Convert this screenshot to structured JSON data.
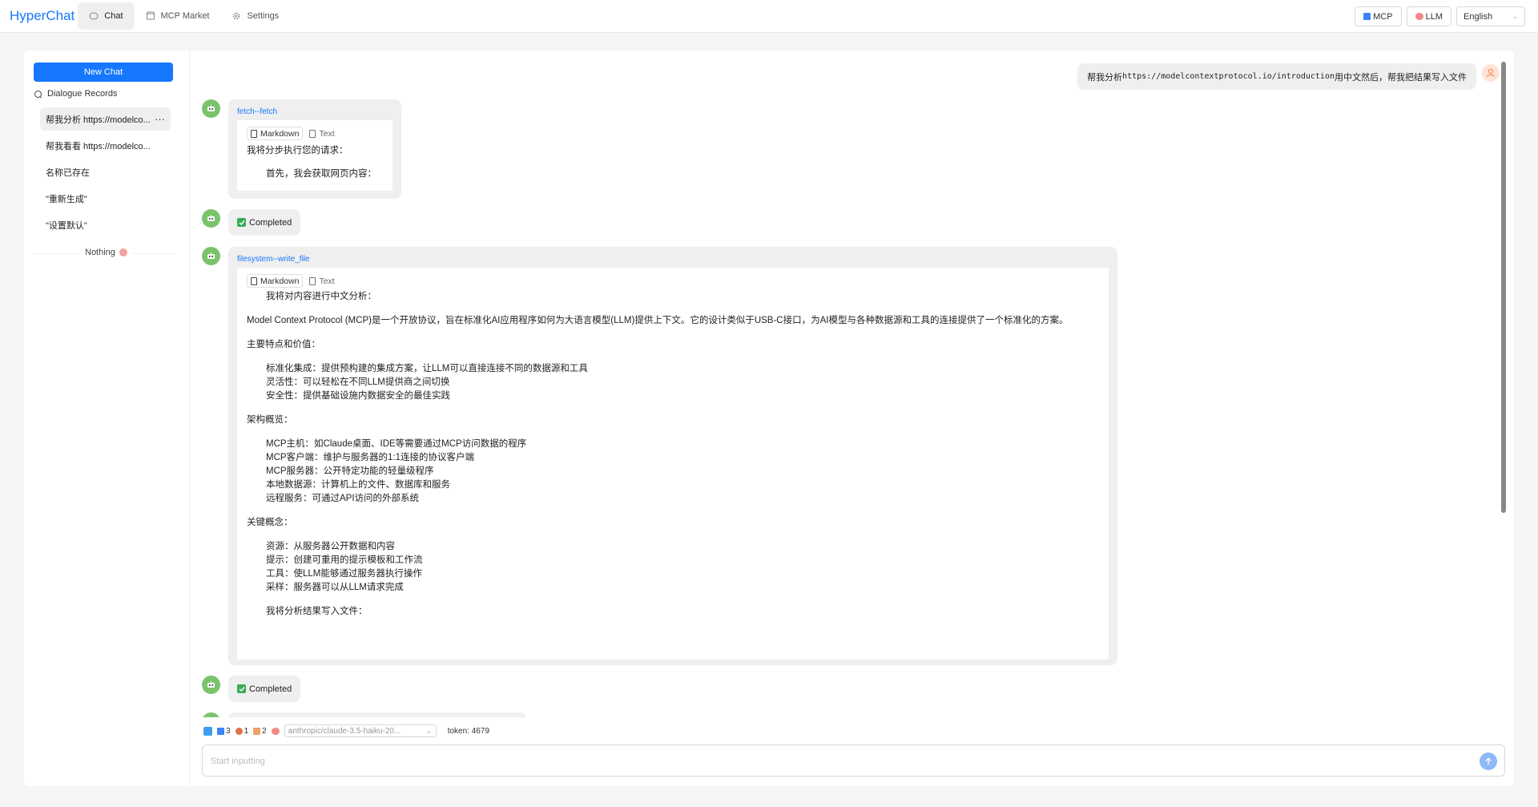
{
  "app": {
    "title": "HyperChat"
  },
  "nav": {
    "tabs": [
      {
        "label": "Chat",
        "icon": "chat-bubble-icon",
        "active": true
      },
      {
        "label": "MCP Market",
        "icon": "shop-icon",
        "active": false
      },
      {
        "label": "Settings",
        "icon": "gear-icon",
        "active": false
      }
    ]
  },
  "header_right": {
    "mcp_label": "MCP",
    "llm_label": "LLM",
    "language": "English"
  },
  "sidebar": {
    "new_chat_label": "New Chat",
    "records_title": "Dialogue Records",
    "records": [
      "帮我分析 https://modelco...",
      "帮我看看 https://modelco...",
      "名称已存在",
      "\"重新生成\"",
      "\"设置默认\""
    ],
    "more_label": "···",
    "empty_label": "Nothing"
  },
  "chat": {
    "user_message": {
      "prefix": "帮我分析 ",
      "url": "https://modelcontextprotocol.io/introduction",
      "suffix": "用中文然后，帮我把结果写入文件"
    },
    "tool_call_1": {
      "name": "fetch--fetch",
      "tabs": [
        "Markdown",
        "Text"
      ],
      "lines": [
        "我将分步执行您的请求：",
        "首先，我会获取网页内容："
      ]
    },
    "completed_label": "Completed",
    "tool_call_2": {
      "name": "filesystem--write_file",
      "tabs": [
        "Markdown",
        "Text"
      ],
      "intro": "我将对内容进行中文分析：",
      "summary": "Model Context Protocol (MCP)是一个开放协议，旨在标准化AI应用程序如何为大语言模型(LLM)提供上下文。它的设计类似于USB-C接口，为AI模型与各种数据源和工具的连接提供了一个标准化的方案。",
      "section_features": "主要特点和价值：",
      "features": [
        "标准化集成：提供预构建的集成方案，让LLM可以直接连接不同的数据源和工具",
        "灵活性：可以轻松在不同LLM提供商之间切换",
        "安全性：提供基础设施内数据安全的最佳实践"
      ],
      "section_arch": "架构概览：",
      "arch": [
        "MCP主机：如Claude桌面、IDE等需要通过MCP访问数据的程序",
        "MCP客户端：维护与服务器的1:1连接的协议客户端",
        "MCP服务器：公开特定功能的轻量级程序",
        "本地数据源：计算机上的文件、数据库和服务",
        "远程服务：可通过API访问的外部系统"
      ],
      "section_concepts": "关键概念：",
      "concepts": [
        "资源：从服务器公开数据和内容",
        "提示：创建可重用的提示模板和工作流",
        "工具：使LLM能够通过服务器执行操作",
        "采样：服务器可以从LLM请求完成"
      ],
      "outro": "我将分析结果写入文件："
    }
  },
  "composer": {
    "stats": {
      "tools": "3",
      "resources": "1",
      "prompts": "2"
    },
    "model": "anthropic/claude-3.5-haiku-20...",
    "token_label": "token: 4679",
    "placeholder": "Start inputting"
  },
  "colors": {
    "accent": "#1677ff",
    "avatar_green": "#7ac36a",
    "success": "#3aab58"
  }
}
